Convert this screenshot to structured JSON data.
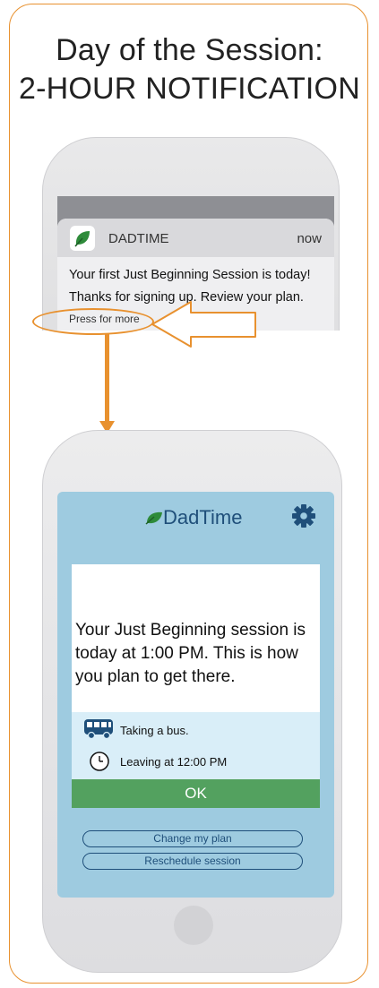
{
  "header": {
    "title_line1": "Day of the Session:",
    "title_line2": "2-HOUR NOTIFICATION"
  },
  "notification": {
    "app_name": "DADTIME",
    "time": "now",
    "line1": "Your first Just Beginning Session is today!",
    "line2": "Thanks for signing up. Review your plan.",
    "more": "Press for more",
    "icon": "leaf-icon"
  },
  "app": {
    "name": "DadTime",
    "message": "Your Just Beginning session is today at 1:00 PM. This is how you plan to get there.",
    "transport": "Taking a bus.",
    "leaving": "Leaving at 12:00 PM",
    "ok_label": "OK",
    "change_label": "Change my plan",
    "reschedule_label": "Reschedule session",
    "icons": [
      "leaf-icon",
      "gear-icon",
      "bus-icon",
      "clock-icon"
    ]
  },
  "colors": {
    "accent_orange": "#e8912f",
    "brand_green": "#53a15f",
    "leaf_green": "#2e8b3a",
    "screen_blue": "#9ecbe0",
    "text_navy": "#1f4f7a"
  }
}
